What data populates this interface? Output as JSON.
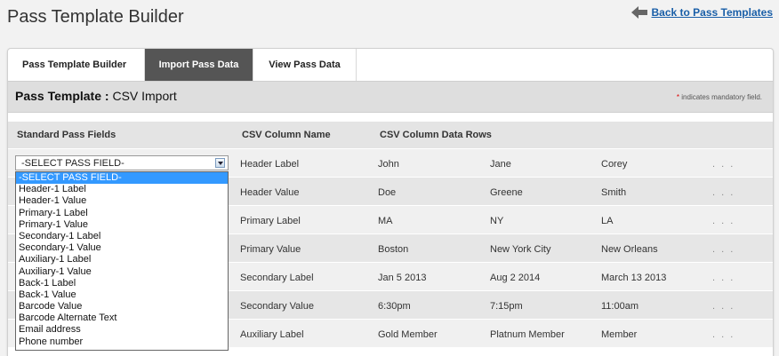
{
  "page": {
    "title": "Pass Template Builder"
  },
  "back_link": {
    "label": "Back to Pass Templates",
    "icon": "arrow-left-icon"
  },
  "tabs": [
    {
      "label": "Pass Template Builder",
      "active": false
    },
    {
      "label": "Import Pass Data",
      "active": true
    },
    {
      "label": "View Pass Data",
      "active": false
    }
  ],
  "section": {
    "title_bold": "Pass Template :",
    "title_rest": "CSV Import",
    "mandatory_star": "*",
    "mandatory_text": "indicates mandatory field."
  },
  "columns": {
    "standard": "Standard Pass Fields",
    "csv_name": "CSV Column Name",
    "csv_rows": "CSV Column Data Rows"
  },
  "rows": [
    {
      "name": "Header Label",
      "c1": "John",
      "c2": "Jane",
      "c3": "Corey",
      "more": ". . ."
    },
    {
      "name": "Header Value",
      "c1": "Doe",
      "c2": "Greene",
      "c3": "Smith",
      "more": ". . ."
    },
    {
      "name": "Primary Label",
      "c1": "MA",
      "c2": "NY",
      "c3": "LA",
      "more": ". . ."
    },
    {
      "name": "Primary Value",
      "c1": "Boston",
      "c2": "New York City",
      "c3": "New Orleans",
      "more": ". . ."
    },
    {
      "name": "Secondary Label",
      "c1": "Jan 5 2013",
      "c2": "Aug 2 2014",
      "c3": "March 13 2013",
      "more": ". . ."
    },
    {
      "name": "Secondary Value",
      "c1": "6:30pm",
      "c2": "7:15pm",
      "c3": "11:00am",
      "more": ". . ."
    },
    {
      "name": "Auxiliary Label",
      "c1": "Gold Member",
      "c2": "Platnum Member",
      "c3": "Member",
      "more": ". . ."
    }
  ],
  "select": {
    "value": "-SELECT PASS FIELD-",
    "options": [
      "-SELECT PASS FIELD-",
      "Header-1 Label",
      "Header-1 Value",
      "Primary-1 Label",
      "Primary-1 Value",
      "Secondary-1 Label",
      "Secondary-1 Value",
      "Auxiliary-1 Label",
      "Auxiliary-1 Value",
      "Back-1 Label",
      "Back-1 Value",
      "Barcode Value",
      "Barcode Alternate Text",
      "Email address",
      "Phone number"
    ]
  }
}
